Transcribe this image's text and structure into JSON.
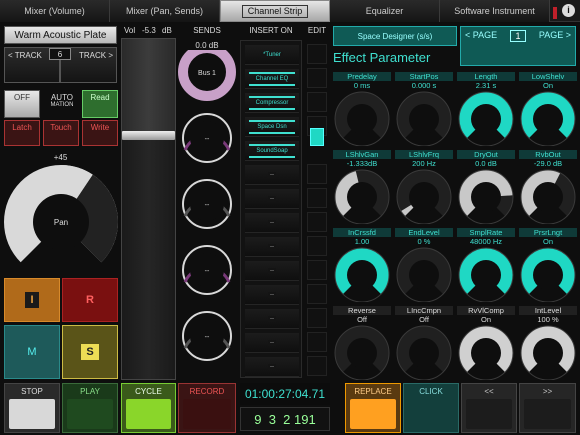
{
  "tabs": [
    "Mixer (Volume)",
    "Mixer (Pan, Sends)",
    "Channel Strip",
    "Equalizer",
    "Software Instrument"
  ],
  "info_icon": "i",
  "left": {
    "track_name": "Warm Acoustic Plate",
    "track_prev": "< TRACK",
    "track_num": "6",
    "track_next": "TRACK >",
    "off": "OFF",
    "auto": "AUTO",
    "auto_sub": "MATION",
    "read": "Read",
    "latch": "Latch",
    "touch": "Touch",
    "write": "Write",
    "pan_value": "+45",
    "pan_label": "Pan",
    "pan_level": 0.625,
    "btn_i": "I",
    "btn_r": "R",
    "btn_m": "M",
    "btn_s": "S"
  },
  "vol": {
    "label": "Vol",
    "value": "-5.3",
    "unit": "dB",
    "level": 0.72
  },
  "sends": {
    "title": "SENDS",
    "value": "0.0 dB",
    "bus": "Bus 1",
    "items": [
      "Bus 1",
      "--",
      "--",
      "--",
      "--"
    ]
  },
  "insert": {
    "title": "INSERT ON",
    "slots": [
      "*Tuner",
      "Channel EQ",
      "Compressor",
      "Space Dsn",
      "SoundSoap",
      "--",
      "--",
      "--",
      "--",
      "--",
      "--",
      "--",
      "--",
      "--"
    ]
  },
  "edit": {
    "title": "EDIT"
  },
  "plugin": {
    "name": "Space Designer (s/s)",
    "title": "Effect Parameter",
    "page_prev": "< PAGE",
    "page_num": "1",
    "page_next": "PAGE >"
  },
  "params": [
    {
      "name": "Predelay",
      "value": "0 ms",
      "level": 0.0,
      "color": "#1a1a1a"
    },
    {
      "name": "StartPos",
      "value": "0.000 s",
      "level": 0.0,
      "color": "#1a1a1a"
    },
    {
      "name": "Length",
      "value": "2.31 s",
      "level": 1.0,
      "color": "#1fd8c4"
    },
    {
      "name": "LowShelv",
      "value": "On",
      "level": 1.0,
      "color": "#1fd8c4"
    },
    {
      "name": "LShlvGan",
      "value": "-1.333dB",
      "level": 0.45,
      "color": "#c8c8c8"
    },
    {
      "name": "LShlvFrq",
      "value": "200 Hz",
      "level": 0.05,
      "color": "#c8c8c8"
    },
    {
      "name": "DryOut",
      "value": "0.0 dB",
      "level": 0.82,
      "color": "#c8c8c8"
    },
    {
      "name": "RvbOut",
      "value": "-29.0 dB",
      "level": 0.6,
      "color": "#c8c8c8"
    },
    {
      "name": "InCrssfd",
      "value": "1.00",
      "level": 1.0,
      "color": "#1fd8c4"
    },
    {
      "name": "EndLevel",
      "value": "0 %",
      "level": 0.0,
      "color": "#1a1a1a"
    },
    {
      "name": "SmplRate",
      "value": "48000 Hz",
      "level": 1.0,
      "color": "#1fd8c4"
    },
    {
      "name": "PrsrLngt",
      "value": "On",
      "level": 1.0,
      "color": "#1fd8c4"
    },
    {
      "name": "Reverse",
      "value": "Off",
      "level": 0.0,
      "color": "#1a1a1a"
    },
    {
      "name": "LIncCmpn",
      "value": "Off",
      "level": 0.0,
      "color": "#1a1a1a"
    },
    {
      "name": "RvVlComp",
      "value": "On",
      "level": 1.0,
      "color": "#d0d0d0"
    },
    {
      "name": "IntLevel",
      "value": "100 %",
      "level": 1.0,
      "color": "#d0d0d0"
    }
  ],
  "transport": {
    "stop": "STOP",
    "play": "PLAY",
    "cycle": "CYCLE",
    "record": "RECORD",
    "time": "01:00:27:04.71",
    "bars": "9  3  2 191",
    "replace": "REPLACE",
    "click": "CLICK",
    "rew": "<<",
    "ff": ">>"
  }
}
